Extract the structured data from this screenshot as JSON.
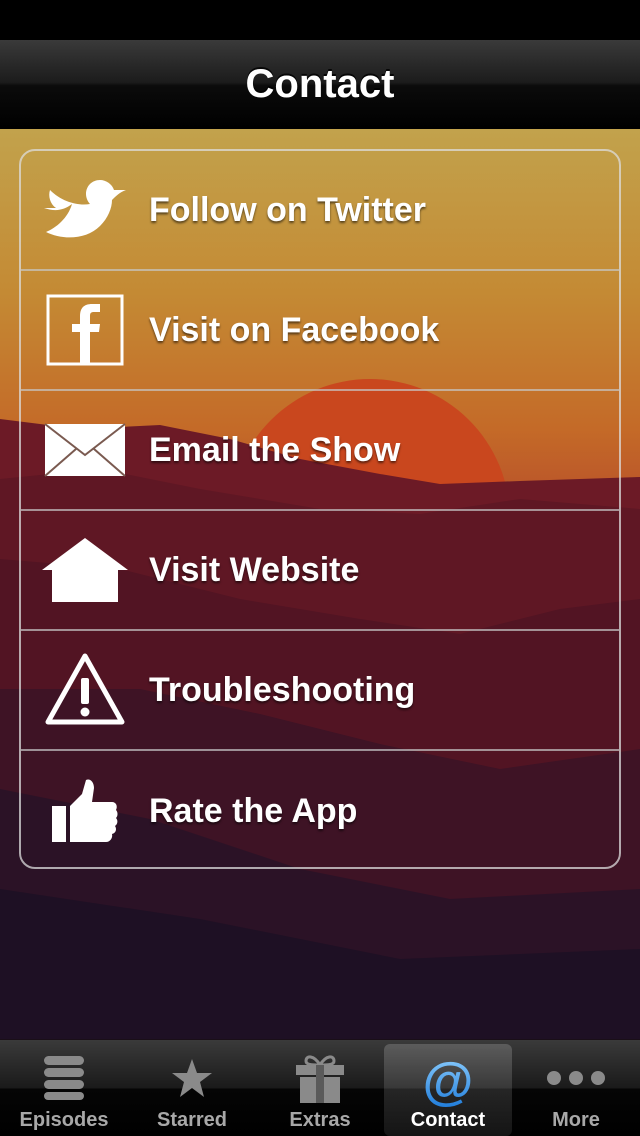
{
  "nav": {
    "title": "Contact"
  },
  "contacts": [
    {
      "label": "Follow on Twitter",
      "icon": "twitter-bird-icon"
    },
    {
      "label": "Visit on Facebook",
      "icon": "facebook-icon"
    },
    {
      "label": "Email the Show",
      "icon": "envelope-icon"
    },
    {
      "label": "Visit Website",
      "icon": "house-icon"
    },
    {
      "label": "Troubleshooting",
      "icon": "warning-icon"
    },
    {
      "label": "Rate the App",
      "icon": "thumbs-up-icon"
    }
  ],
  "tabs": [
    {
      "label": "Episodes",
      "icon": "list-icon",
      "active": false
    },
    {
      "label": "Starred",
      "icon": "star-icon",
      "active": false
    },
    {
      "label": "Extras",
      "icon": "gift-icon",
      "active": false
    },
    {
      "label": "Contact",
      "icon": "at-sign-icon",
      "active": true
    },
    {
      "label": "More",
      "icon": "more-dots-icon",
      "active": false
    }
  ],
  "colors": {
    "sky_top": "#c2a24c",
    "sky_mid": "#c46a28",
    "sun": "#c9471e",
    "hills": "#5a1424",
    "active_tab_icon": "#3a9ae8"
  }
}
